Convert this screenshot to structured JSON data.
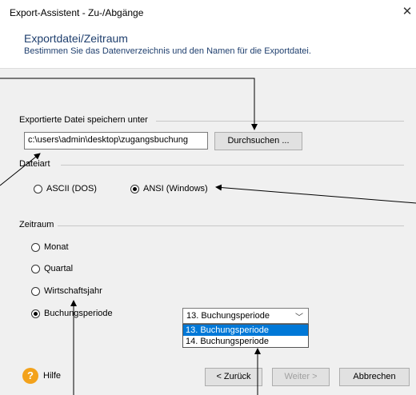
{
  "window": {
    "title": "Export-Assistent - Zu-/Abgänge"
  },
  "header": {
    "title": "Exportdatei/Zeitraum",
    "subtitle": "Bestimmen Sie das Datenverzeichnis und den Namen für die Exportdatei."
  },
  "export_group": {
    "label": "Exportierte Datei speichern unter",
    "path_value": "c:\\users\\admin\\desktop\\zugangsbuchung",
    "browse_label": "Durchsuchen ..."
  },
  "filetype_group": {
    "label": "Dateiart",
    "options": [
      {
        "label": "ASCII (DOS)",
        "checked": false
      },
      {
        "label": "ANSI (Windows)",
        "checked": true
      }
    ]
  },
  "period_group": {
    "label": "Zeitraum",
    "options": [
      {
        "label": "Monat",
        "checked": false
      },
      {
        "label": "Quartal",
        "checked": false
      },
      {
        "label": "Wirtschaftsjahr",
        "checked": false
      },
      {
        "label": "Buchungsperiode",
        "checked": true
      }
    ],
    "select_value": "13. Buchungsperiode",
    "dropdown_options": [
      "13. Buchungsperiode",
      "14. Buchungsperiode"
    ]
  },
  "footer": {
    "help_label": "Hilfe",
    "back_label": "< Zurück",
    "next_label": "Weiter >",
    "cancel_label": "Abbrechen"
  }
}
